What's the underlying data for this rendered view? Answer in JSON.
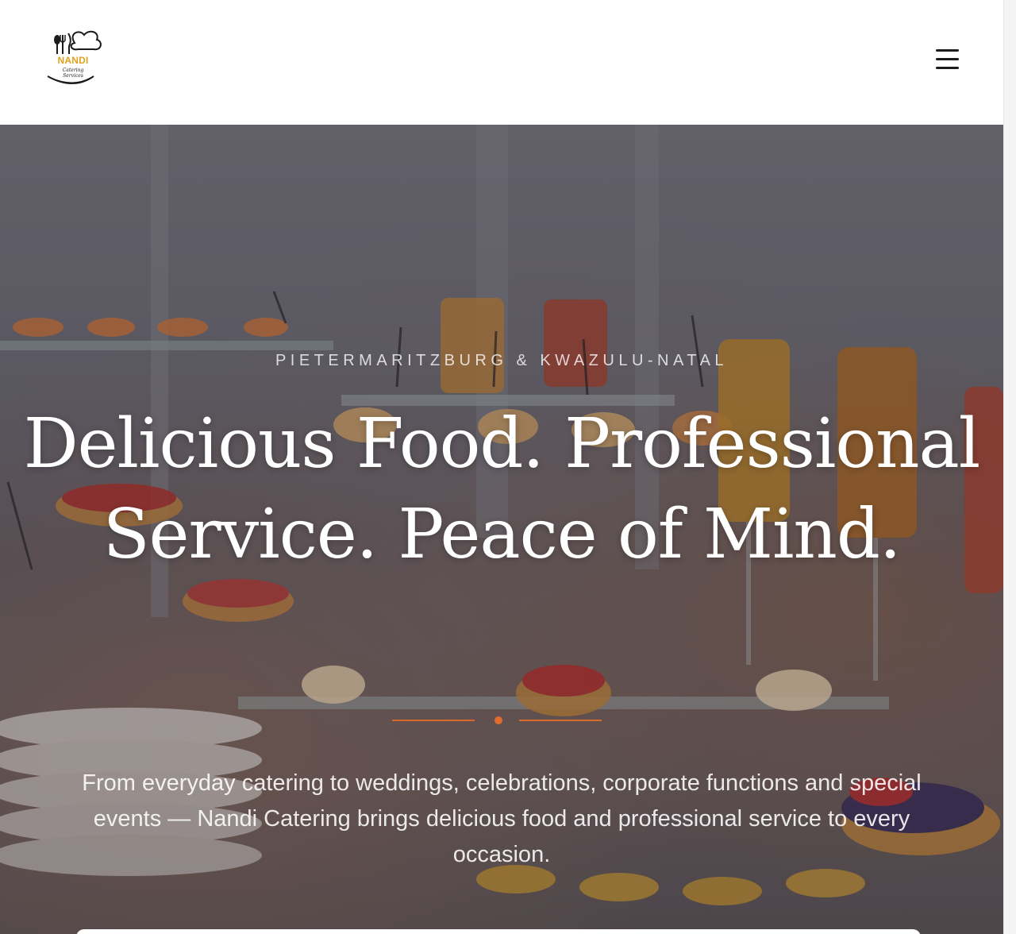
{
  "brand": {
    "logo_name": "NANDI",
    "logo_tagline": "Catering Services",
    "accent_color": "#e06b2a",
    "logo_color": "#e0a21c"
  },
  "header": {
    "menu_icon": "hamburger-menu-icon"
  },
  "hero": {
    "kicker": "PIETERMARITZBURG & KWAZULU-NATAL",
    "title": "Delicious Food. Professional Service. Peace of Mind.",
    "description": "From everyday catering to weddings, celebrations, corporate functions and special events — Nandi Catering brings delicious food and professional service to every occasion."
  }
}
